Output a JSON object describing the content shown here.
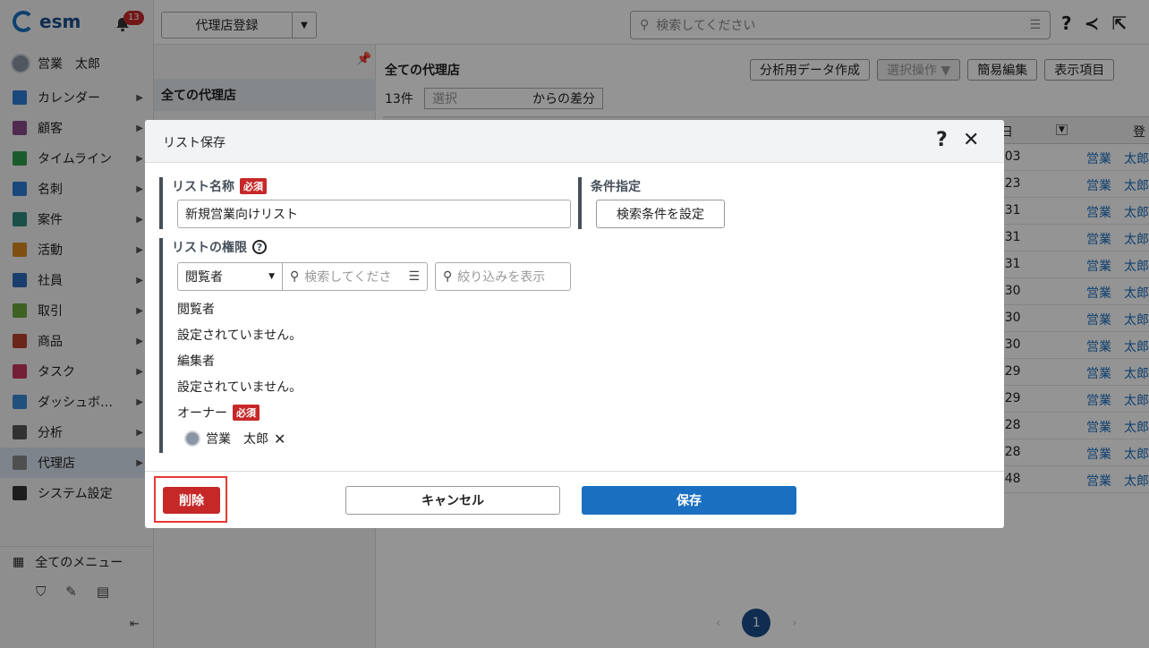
{
  "app": {
    "logo": "esm",
    "notification_count": "13",
    "user_name": "営業　太郎"
  },
  "sidebar": {
    "items": [
      {
        "label": "カレンダー",
        "color": "#2e7bd6"
      },
      {
        "label": "顧客",
        "color": "#8a4a8a"
      },
      {
        "label": "タイムライン",
        "color": "#2e9d4a"
      },
      {
        "label": "名刺",
        "color": "#2e7bd6"
      },
      {
        "label": "案件",
        "color": "#2e8a7a"
      },
      {
        "label": "活動",
        "color": "#d98b1e"
      },
      {
        "label": "社員",
        "color": "#2e6bbd"
      },
      {
        "label": "取引",
        "color": "#6aa83a"
      },
      {
        "label": "商品",
        "color": "#b5432b"
      },
      {
        "label": "タスク",
        "color": "#c8365e"
      },
      {
        "label": "ダッシュボ…",
        "color": "#3a8ad6"
      },
      {
        "label": "分析",
        "color": "#555555"
      },
      {
        "label": "代理店",
        "color": "#888888"
      },
      {
        "label": "システム設定",
        "color": "#333333"
      }
    ],
    "all_menu": "全てのメニュー"
  },
  "topbar": {
    "register_label": "代理店登録",
    "search_placeholder": "検索してください"
  },
  "listpane": {
    "header": "全ての代理店"
  },
  "main": {
    "title": "全ての代理店",
    "buttons": [
      "分析用データ作成",
      "選択操作 ▼",
      "簡易編集",
      "表示項目"
    ],
    "count": "13件",
    "select_placeholder": "選択",
    "select_suffix": "からの差分",
    "col_header_fragment": "日",
    "col_header_fragment2": "登",
    "rows": [
      {
        "time": ":03",
        "link": "営業　太郎"
      },
      {
        "time": ":23",
        "link": "営業　太郎"
      },
      {
        "time": ":31",
        "link": "営業　太郎"
      },
      {
        "time": ":31",
        "link": "営業　太郎"
      },
      {
        "time": ":31",
        "link": "営業　太郎"
      },
      {
        "time": ":30",
        "link": "営業　太郎"
      },
      {
        "time": ":30",
        "link": "営業　太郎"
      },
      {
        "time": ":30",
        "link": "営業　太郎"
      },
      {
        "time": ":29",
        "link": "営業　太郎"
      },
      {
        "time": ":29",
        "link": "営業　太郎"
      },
      {
        "time": ":28",
        "link": "営業　太郎"
      },
      {
        "time": ":28",
        "link": "営業　太郎"
      },
      {
        "time": ":48",
        "link": "営業　太郎"
      }
    ],
    "page": "1"
  },
  "modal": {
    "title": "リスト保存",
    "list_name_label": "リスト名称",
    "required": "必須",
    "list_name_value": "新規営業向けリスト",
    "condition_label": "条件指定",
    "condition_button": "検索条件を設定",
    "permission_label": "リストの権限",
    "role_select": "閲覧者",
    "perm_search_placeholder": "検索してくださ",
    "filter_placeholder": "絞り込みを表示",
    "viewer_label": "閲覧者",
    "viewer_value": "設定されていません。",
    "editor_label": "編集者",
    "editor_value": "設定されていません。",
    "owner_label": "オーナー",
    "owner_name": "営業　太郎",
    "delete_button": "削除",
    "cancel_button": "キャンセル",
    "save_button": "保存"
  }
}
